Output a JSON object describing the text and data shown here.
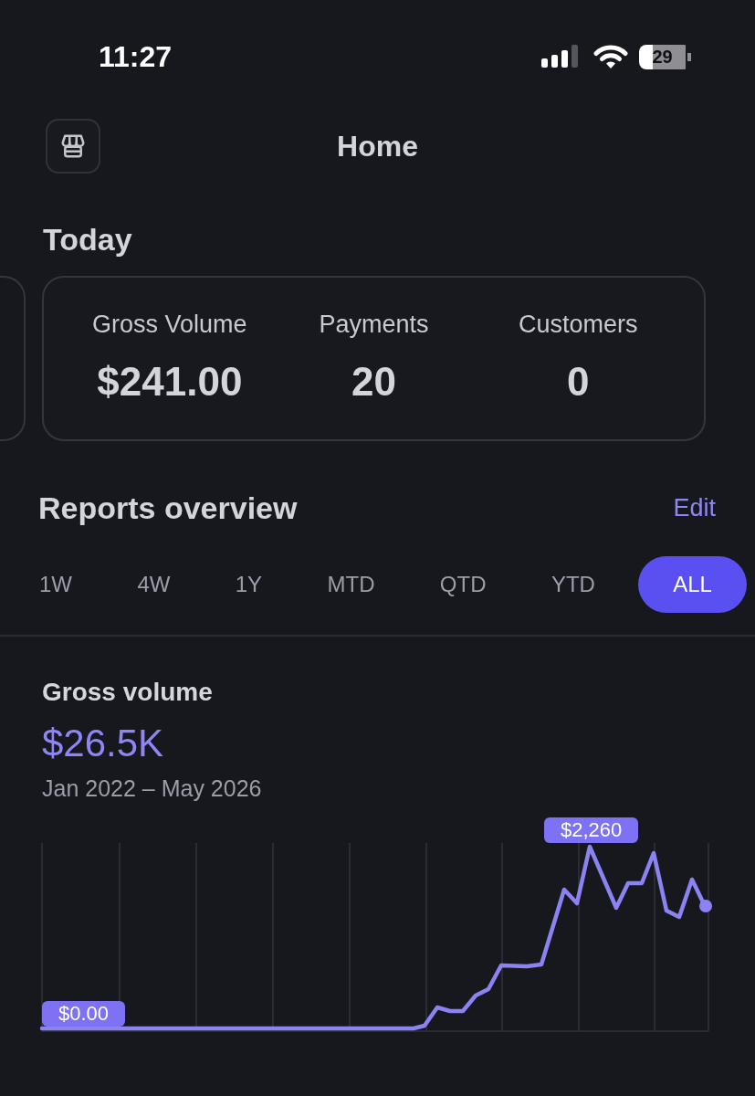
{
  "status_bar": {
    "time": "11:27",
    "battery": "29"
  },
  "header": {
    "title": "Home"
  },
  "today": {
    "title": "Today",
    "metrics": [
      {
        "label": "Gross Volume",
        "value": "$241.00"
      },
      {
        "label": "Payments",
        "value": "20"
      },
      {
        "label": "Customers",
        "value": "0"
      }
    ]
  },
  "reports_overview": {
    "title": "Reports overview",
    "edit": "Edit",
    "tabs": [
      {
        "label": "1W",
        "selected": false
      },
      {
        "label": "4W",
        "selected": false
      },
      {
        "label": "1Y",
        "selected": false
      },
      {
        "label": "MTD",
        "selected": false
      },
      {
        "label": "QTD",
        "selected": false
      },
      {
        "label": "YTD",
        "selected": false
      },
      {
        "label": "ALL",
        "selected": true
      }
    ]
  },
  "gross_volume": {
    "title": "Gross volume",
    "total": "$26.5K",
    "date_range": "Jan 2022 – May 2026",
    "chart": {
      "peak_label": "$2,260",
      "start_label": "$0.00"
    }
  }
}
